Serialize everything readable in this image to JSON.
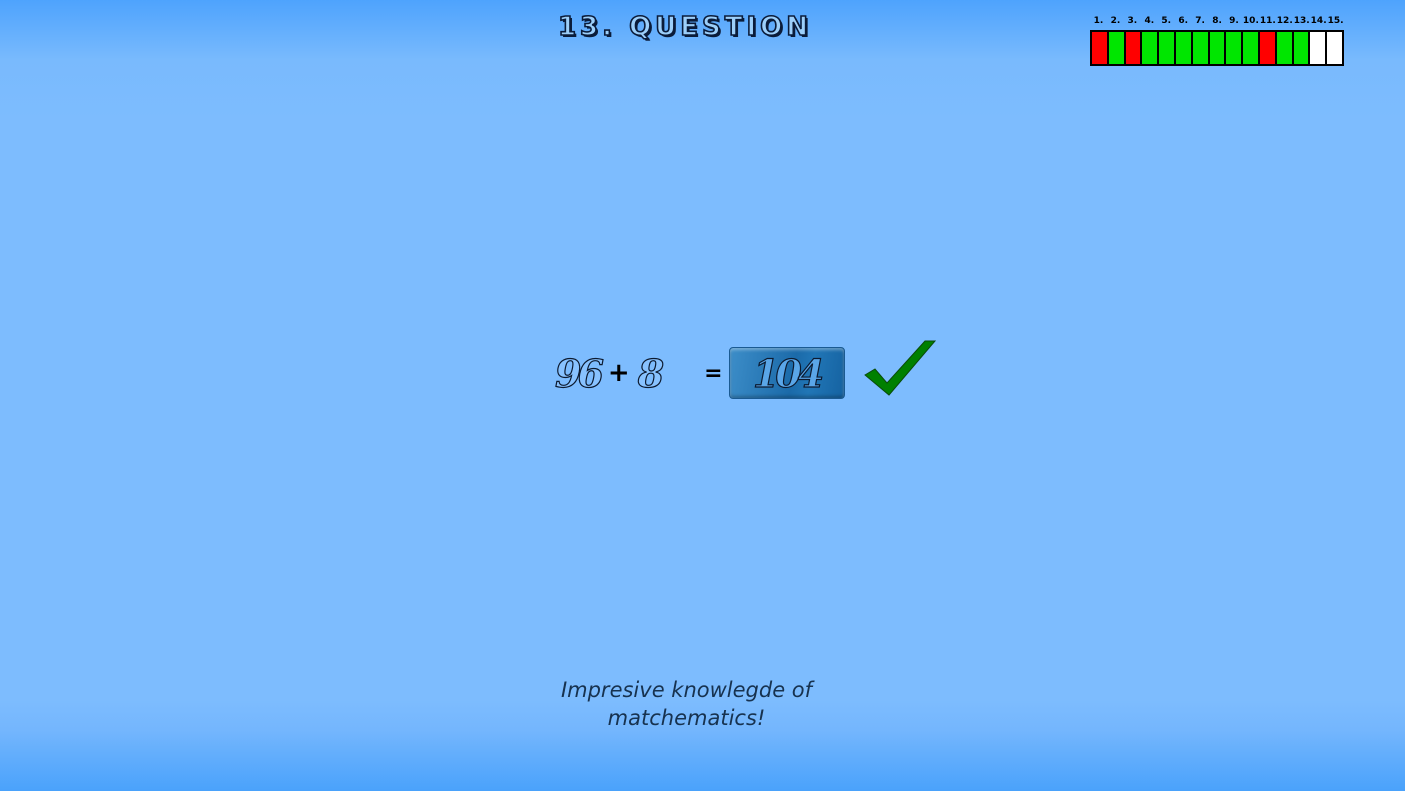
{
  "header": {
    "title": "13. QUESTION"
  },
  "progress": {
    "labels": [
      "1.",
      "2.",
      "3.",
      "4.",
      "5.",
      "6.",
      "7.",
      "8.",
      "9.",
      "10.",
      "11.",
      "12.",
      "13.",
      "14.",
      "15."
    ],
    "states": [
      "wrong",
      "correct",
      "wrong",
      "correct",
      "correct",
      "correct",
      "correct",
      "correct",
      "correct",
      "correct",
      "wrong",
      "correct",
      "correct",
      "pending",
      "pending"
    ],
    "colors": {
      "correct": "#00e600",
      "wrong": "#ff0000",
      "pending": "#ffffff"
    }
  },
  "problem": {
    "left_operand": "96",
    "operator": "+",
    "right_operand": "8",
    "equals": "=",
    "answer": "104",
    "result": "correct",
    "result_icon": "checkmark-icon",
    "check_color": "#008000"
  },
  "feedback": {
    "line1": "Impresive knowlegde of",
    "line2": "matchematics!"
  }
}
